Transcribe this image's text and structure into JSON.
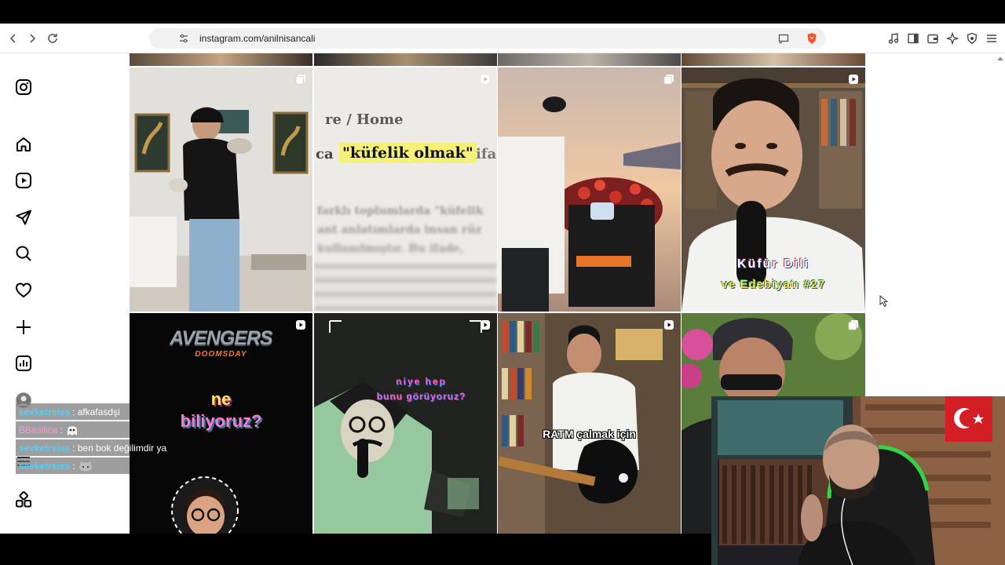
{
  "browser": {
    "url": "instagram.com/anilnisancali"
  },
  "sidebar": {
    "items": [
      {
        "icon": "instagram-logo-icon"
      },
      {
        "icon": "home-icon"
      },
      {
        "icon": "reels-icon"
      },
      {
        "icon": "messages-icon"
      },
      {
        "icon": "search-icon"
      },
      {
        "icon": "notifications-heart-icon"
      },
      {
        "icon": "create-plus-icon"
      },
      {
        "icon": "dashboard-icon"
      },
      {
        "icon": "profile-avatar"
      },
      {
        "icon": "more-menu-icon"
      },
      {
        "icon": "also-from-meta-icon"
      }
    ]
  },
  "grid": {
    "posts": [
      {
        "type": "carousel",
        "title": ""
      },
      {
        "type": "reel",
        "title": "",
        "text_line_1": "re / Home",
        "text_prefix": "ca",
        "highlight": "\"küfelik olmak\"",
        "text_suffix": "ifa",
        "blur_1": "farklı toplumlarda \"küfelik",
        "blur_2": "ant anlatımlarda insan rüz",
        "blur_3": "kullanılmıştır. Bu ifade,"
      },
      {
        "type": "carousel",
        "title": ""
      },
      {
        "type": "reel",
        "caption_1": "Küfür Dili",
        "caption_2": "ve Edebiyatı #27"
      },
      {
        "type": "reel",
        "brand": "AVENGERS",
        "brand_sub": "DOOMSDAY",
        "line_1": "ne",
        "line_2": "biliyoruz?"
      },
      {
        "type": "reel",
        "line_1": "niye hep",
        "line_2": "bunu görüyoruz?"
      },
      {
        "type": "reel",
        "caption": "RATM çalmak için"
      },
      {
        "type": "carousel",
        "title": ""
      }
    ]
  },
  "chat": {
    "messages": [
      {
        "user": "sevketreiss",
        "text": "afkafasdşi",
        "user_color": "#4fd0ff"
      },
      {
        "user": "BBasilica",
        "text": "",
        "user_color": "#ff9bd0",
        "emote": "ghost-emote"
      },
      {
        "user": "sevketreiss",
        "text": "ben bok değilimdir ya",
        "user_color": "#4fd0ff"
      },
      {
        "user": "sevketreiss",
        "text": "",
        "user_color": "#4fd0ff",
        "emote": "cat-emote"
      }
    ]
  },
  "colors": {
    "highlight_yellow": "#f4f07a",
    "accent_brave": "#fb542b"
  }
}
